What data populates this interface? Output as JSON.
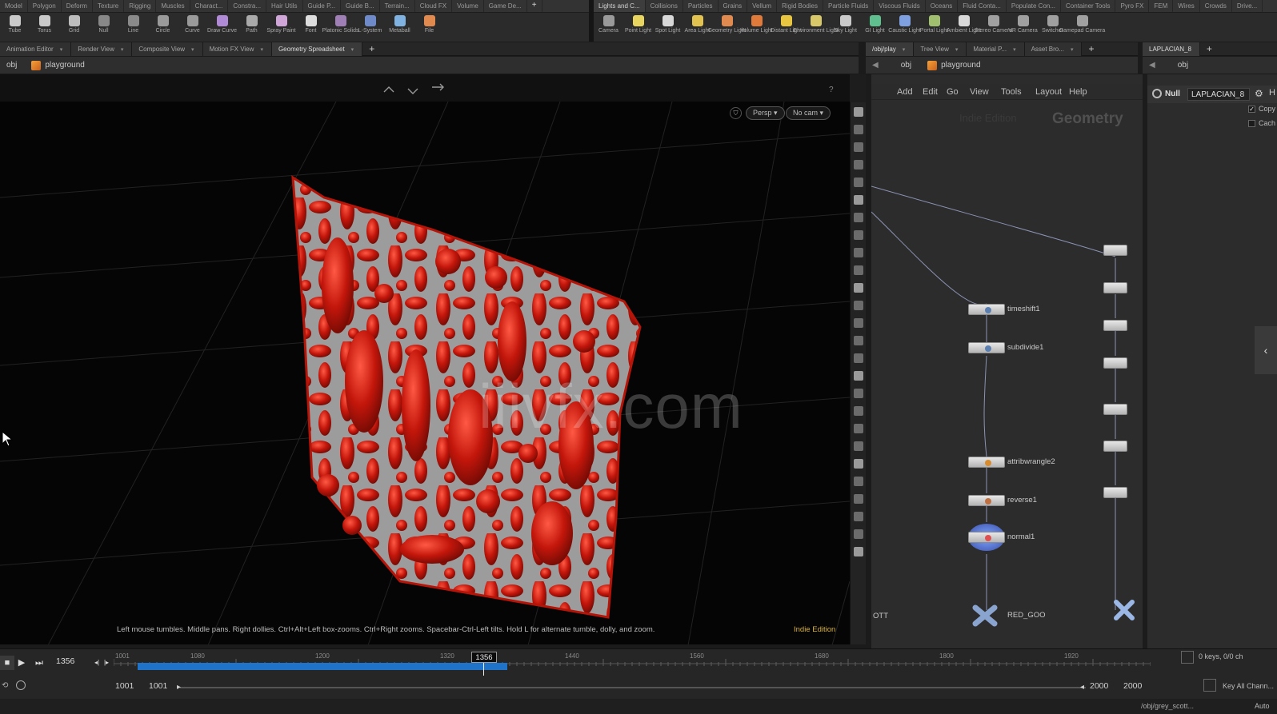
{
  "shelf_left": {
    "tabs": [
      "Model",
      "Polygon",
      "Deform",
      "Texture",
      "Rigging",
      "Muscles",
      "Charact...",
      "Constra...",
      "Hair Utils",
      "Guide P...",
      "Guide B...",
      "Terrain...",
      "Cloud FX",
      "Volume",
      "Game De..."
    ],
    "plus": "+",
    "tools": [
      {
        "label": "Tube",
        "color": "#c9c9c9"
      },
      {
        "label": "Torus",
        "color": "#c9c9c9"
      },
      {
        "label": "Grid",
        "color": "#bdbdbd"
      },
      {
        "label": "Null",
        "color": "#888888"
      },
      {
        "label": "Line",
        "color": "#8a8a8a"
      },
      {
        "label": "Circle",
        "color": "#9a9a9a"
      },
      {
        "label": "Curve",
        "color": "#9a9a9a"
      },
      {
        "label": "Draw Curve",
        "color": "#b08ad6"
      },
      {
        "label": "Path",
        "color": "#aaaaaa"
      },
      {
        "label": "Spray Paint",
        "color": "#d0a6d8"
      },
      {
        "label": "Font",
        "color": "#dddddd"
      },
      {
        "label": "Platonic Solids",
        "color": "#9f7fb5"
      },
      {
        "label": "L-System",
        "color": "#6f8ac9"
      },
      {
        "label": "Metaball",
        "color": "#7fb2e0"
      },
      {
        "label": "File",
        "color": "#e08a4f"
      }
    ]
  },
  "shelf_right": {
    "tabs": [
      "Lights and C...",
      "Collisions",
      "Particles",
      "Grains",
      "Vellum",
      "Rigid Bodies",
      "Particle Fluids",
      "Viscous Fluids",
      "Oceans",
      "Fluid Conta...",
      "Populate Con...",
      "Container Tools",
      "Pyro FX",
      "FEM",
      "Wires",
      "Crowds",
      "Drive..."
    ],
    "tools": [
      {
        "label": "Camera",
        "color": "#9a9a9a"
      },
      {
        "label": "Point Light",
        "color": "#e8d560"
      },
      {
        "label": "Spot Light",
        "color": "#d8d8d8"
      },
      {
        "label": "Area Light",
        "color": "#e3c34f"
      },
      {
        "label": "Geometry Light",
        "color": "#e08a4f"
      },
      {
        "label": "Volume Light",
        "color": "#e07a3a"
      },
      {
        "label": "Distant Light",
        "color": "#e8c540"
      },
      {
        "label": "Environment Light",
        "color": "#d8c86a"
      },
      {
        "label": "Sky Light",
        "color": "#c9c9c9"
      },
      {
        "label": "GI Light",
        "color": "#5fbf8f"
      },
      {
        "label": "Caustic Light",
        "color": "#7fa0e0"
      },
      {
        "label": "Portal Light",
        "color": "#a0c070"
      },
      {
        "label": "Ambient Light",
        "color": "#d8d8d8"
      },
      {
        "label": "Stereo Camera",
        "color": "#a0a0a0"
      },
      {
        "label": "VR Camera",
        "color": "#a0a0a0"
      },
      {
        "label": "Switcher",
        "color": "#a0a0a0"
      },
      {
        "label": "Gamepad Camera",
        "color": "#a0a0a0"
      }
    ]
  },
  "left_pane_tabs": [
    "Animation Editor",
    "Render View",
    "Composite View",
    "Motion FX View",
    "Geometry Spreadsheet"
  ],
  "left_path": {
    "obj": "obj",
    "network": "playground"
  },
  "mid_pane_tabs": [
    "/obj/play",
    "Tree View",
    "Material P...",
    "Asset Bro..."
  ],
  "mid_path": {
    "obj": "obj",
    "network": "playground"
  },
  "right_pane_tab": "LAPLACIAN_8",
  "right_path": {
    "obj": "obj"
  },
  "viewport": {
    "persp_label": "Persp",
    "cam_label": "No cam",
    "hint": "Left mouse tumbles. Middle pans. Right dollies. Ctrl+Alt+Left box-zooms. Ctrl+Right zooms. Spacebar-Ctrl-Left tilts. Hold L for alternate tumble, dolly, and zoom.",
    "edition": "Indie Edition",
    "watermark": "iiivfx.com"
  },
  "network": {
    "menu": [
      "Add",
      "Edit",
      "Go",
      "View",
      "Tools",
      "Layout",
      "Help"
    ],
    "bg_title": "Geometry",
    "bg_edition": "Indie Edition",
    "nodes": [
      {
        "name": "timeshift1",
        "color": "#5a7fb0"
      },
      {
        "name": "subdivide1",
        "color": "#5a7fb0"
      },
      {
        "name": "attribwrangle2",
        "color": "#d88b2f"
      },
      {
        "name": "reverse1",
        "color": "#c07040"
      },
      {
        "name": "normal1",
        "color": "#e05050"
      },
      {
        "name": "RED_GOO",
        "color": "#8aa4d0"
      }
    ],
    "left_edge_text": "OTT"
  },
  "params": {
    "node_type": "Null",
    "node_name": "LAPLACIAN_8",
    "checks": [
      {
        "label": "Copy",
        "checked": true
      },
      {
        "label": "Cach",
        "checked": false
      }
    ]
  },
  "timeline": {
    "current_frame": "1356",
    "ruler_labels": [
      "1001",
      "1080",
      "1200",
      "1320",
      "1440",
      "1560",
      "1680",
      "1800",
      "1920"
    ],
    "start": "1001",
    "start2": "1001",
    "end": "2000",
    "end2": "2000",
    "keys_label": "0 keys, 0/0 ch",
    "key_all": "Key All Chann...",
    "status_path": "/obj/grey_scott...",
    "auto": "Auto"
  },
  "colors": {
    "accent_blue": "#1f74c9",
    "goo_red": "#c0170d",
    "surface_grey": "#9e9e9e"
  }
}
